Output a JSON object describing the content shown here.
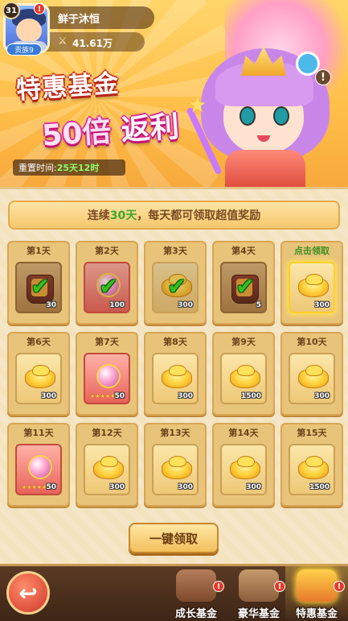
{
  "player": {
    "level": "31",
    "name": "鲜于沐恒",
    "power": "41.61万",
    "rank_label": "贡族9",
    "power_icon": "crossed-swords-icon"
  },
  "banner": {
    "title_line1": "特惠基金",
    "title_line2_num": "50倍",
    "title_line2_text": "返利",
    "reset_label": "重置时间:",
    "reset_value": "25天12时",
    "info_glyph": "!"
  },
  "notice": {
    "prefix": "连续",
    "days": "30天",
    "suffix": "每天都可领取超值奖励"
  },
  "rewards": [
    {
      "day": "第1天",
      "item": "chest",
      "qty": "30",
      "claimed": true
    },
    {
      "day": "第2天",
      "item": "orb-chest",
      "qty": "100",
      "claimed": true
    },
    {
      "day": "第3天",
      "item": "gold-ingot",
      "qty": "300",
      "claimed": true
    },
    {
      "day": "第4天",
      "item": "chest",
      "qty": "5",
      "claimed": true
    },
    {
      "day": "点击领取",
      "item": "gold-ingot",
      "qty": "300",
      "claimed": false,
      "claimable": true
    },
    {
      "day": "第6天",
      "item": "gold-ingot",
      "qty": "300",
      "claimed": false
    },
    {
      "day": "第7天",
      "item": "orb",
      "qty": "50",
      "claimed": false
    },
    {
      "day": "第8天",
      "item": "gold-ingot",
      "qty": "300",
      "claimed": false
    },
    {
      "day": "第9天",
      "item": "gold-ingot",
      "qty": "1500",
      "claimed": false
    },
    {
      "day": "第10天",
      "item": "gold-ingot",
      "qty": "300",
      "claimed": false
    },
    {
      "day": "第11天",
      "item": "orb",
      "qty": "50",
      "claimed": false
    },
    {
      "day": "第12天",
      "item": "gold-ingot",
      "qty": "300",
      "claimed": false
    },
    {
      "day": "第13天",
      "item": "gold-ingot",
      "qty": "300",
      "claimed": false
    },
    {
      "day": "第14天",
      "item": "gold-ingot",
      "qty": "300",
      "claimed": false
    },
    {
      "day": "第15天",
      "item": "gold-ingot",
      "qty": "1500",
      "claimed": false
    }
  ],
  "claim_all_label": "一键领取",
  "bottom_nav": {
    "back_icon": "back-arrow-icon",
    "tabs": [
      {
        "label": "成长基金",
        "icon": "growth-fund-icon",
        "active": false,
        "badge": "!"
      },
      {
        "label": "豪华基金",
        "icon": "luxury-fund-icon",
        "active": false,
        "badge": "!"
      },
      {
        "label": "特惠基金",
        "icon": "special-fund-icon",
        "active": true,
        "badge": "!"
      }
    ]
  },
  "colors": {
    "accent_gold": "#f2bf5c",
    "claim_green": "#3e8f21",
    "badge_red": "#e63a2a"
  }
}
